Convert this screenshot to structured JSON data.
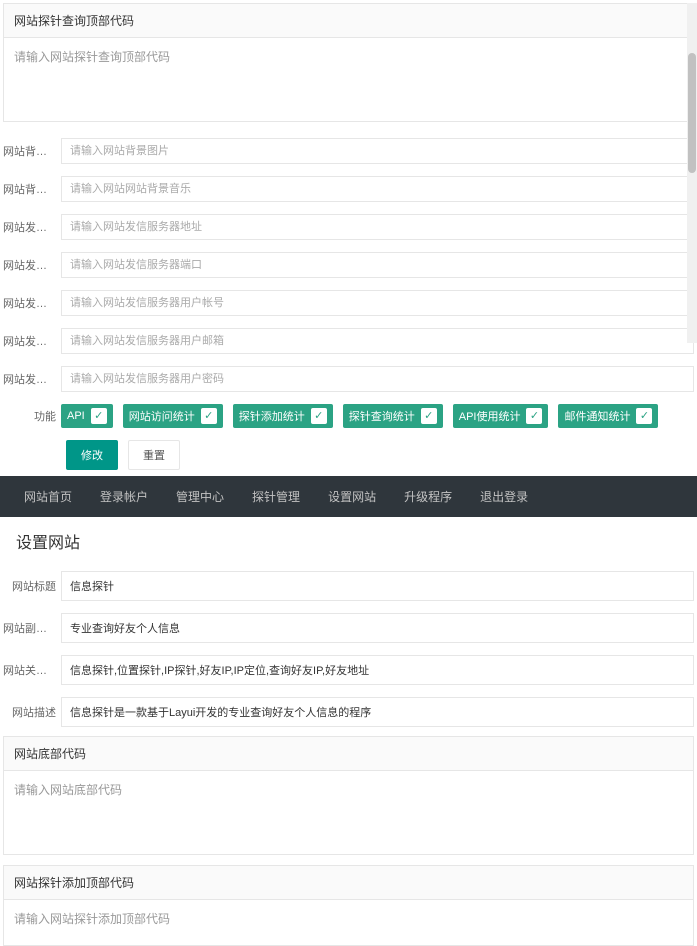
{
  "top": {
    "probeQueryHeader": {
      "title": "网站探针查询顶部代码",
      "placeholder": "请输入网站探针查询顶部代码"
    },
    "fields": {
      "bgImage": {
        "label": "网站背景...",
        "placeholder": "请输入网站背景图片"
      },
      "bgMusic": {
        "label": "网站背景...",
        "placeholder": "请输入网站网站背景音乐"
      },
      "mailServer": {
        "label": "网站发信...",
        "placeholder": "请输入网站发信服务器地址"
      },
      "mailPort": {
        "label": "网站发信...",
        "placeholder": "请输入网站发信服务器端口"
      },
      "mailUser": {
        "label": "网站发信...",
        "placeholder": "请输入网站发信服务器用户帐号"
      },
      "mailMailbox": {
        "label": "网站发信...",
        "placeholder": "请输入网站发信服务器用户邮箱"
      },
      "mailPass": {
        "label": "网站发信...",
        "placeholder": "请输入网站发信服务器用户密码"
      }
    },
    "features": {
      "label": "功能",
      "tags": [
        "API",
        "网站访问统计",
        "探针添加统计",
        "探针查询统计",
        "API使用统计",
        "邮件通知统计"
      ]
    },
    "buttons": {
      "submit": "修改",
      "reset": "重置"
    }
  },
  "nav": {
    "items": [
      "网站首页",
      "登录帐户",
      "管理中心",
      "探针管理",
      "设置网站",
      "升级程序",
      "退出登录"
    ]
  },
  "pageTitle": "设置网站",
  "bottom": {
    "fields": {
      "title": {
        "label": "网站标题",
        "value": "信息探针"
      },
      "subtitle": {
        "label": "网站副标题",
        "value": "专业查询好友个人信息"
      },
      "keywords": {
        "label": "网站关键词",
        "value": "信息探针,位置探针,IP探针,好友IP,IP定位,查询好友IP,好友地址"
      },
      "description": {
        "label": "网站描述",
        "value": "信息探针是一款基于Layui开发的专业查询好友个人信息的程序"
      }
    },
    "footerCode": {
      "title": "网站底部代码",
      "placeholder": "请输入网站底部代码"
    },
    "probeAddHeader": {
      "title": "网站探针添加顶部代码",
      "placeholder": "请输入网站探针添加顶部代码"
    }
  }
}
